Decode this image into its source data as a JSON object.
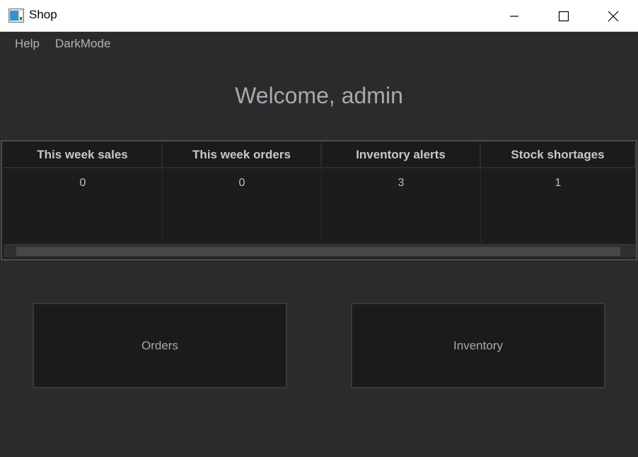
{
  "window": {
    "title": "Shop"
  },
  "menu": {
    "items": [
      "Help",
      "DarkMode"
    ]
  },
  "welcome": "Welcome, admin",
  "table": {
    "headers": [
      "This week sales",
      "This week orders",
      "Inventory alerts",
      "Stock shortages"
    ],
    "rows": [
      [
        "0",
        "0",
        "3",
        "1"
      ]
    ]
  },
  "buttons": {
    "orders": "Orders",
    "inventory": "Inventory"
  },
  "colors": {
    "background": "#2b2b2d",
    "panel": "#1c1c1d",
    "text": "#a9a9ad",
    "titlebar": "#ffffff"
  },
  "icons": [
    "app-icon",
    "minimize-icon",
    "maximize-icon",
    "close-icon"
  ]
}
